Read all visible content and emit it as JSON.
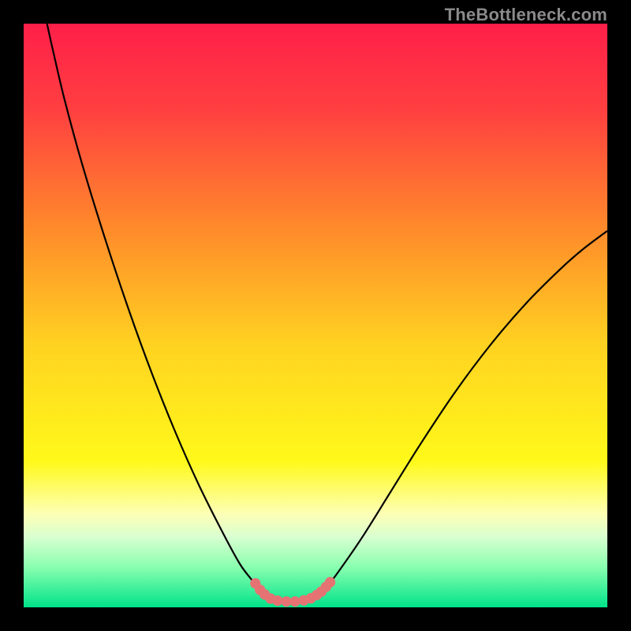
{
  "watermark": {
    "text": "TheBottleneck.com"
  },
  "chart_data": {
    "type": "line",
    "title": "",
    "xlabel": "",
    "ylabel": "",
    "xlim": [
      0,
      100
    ],
    "ylim": [
      0,
      100
    ],
    "grid": false,
    "legend": false,
    "background": {
      "gradient_stops": [
        {
          "offset": 0.0,
          "color": "#ff1f49"
        },
        {
          "offset": 0.15,
          "color": "#ff4040"
        },
        {
          "offset": 0.35,
          "color": "#ff8a2b"
        },
        {
          "offset": 0.55,
          "color": "#ffd221"
        },
        {
          "offset": 0.75,
          "color": "#fff91a"
        },
        {
          "offset": 0.84,
          "color": "#fdffb6"
        },
        {
          "offset": 0.88,
          "color": "#d8ffd0"
        },
        {
          "offset": 0.93,
          "color": "#8bffb0"
        },
        {
          "offset": 1.0,
          "color": "#00e38a"
        }
      ]
    },
    "series": [
      {
        "name": "bottleneck-curve",
        "color": "#000000",
        "points": [
          {
            "x": 4.0,
            "y": 100.0
          },
          {
            "x": 5.0,
            "y": 95.5
          },
          {
            "x": 7.0,
            "y": 87.0
          },
          {
            "x": 10.0,
            "y": 76.0
          },
          {
            "x": 14.0,
            "y": 63.0
          },
          {
            "x": 18.0,
            "y": 51.0
          },
          {
            "x": 22.0,
            "y": 40.0
          },
          {
            "x": 26.0,
            "y": 30.0
          },
          {
            "x": 30.0,
            "y": 21.0
          },
          {
            "x": 34.0,
            "y": 13.0
          },
          {
            "x": 37.0,
            "y": 7.5
          },
          {
            "x": 39.0,
            "y": 4.8
          },
          {
            "x": 40.0,
            "y": 3.5
          },
          {
            "x": 41.2,
            "y": 2.3
          },
          {
            "x": 42.5,
            "y": 1.5
          },
          {
            "x": 44.0,
            "y": 1.1
          },
          {
            "x": 46.0,
            "y": 1.0
          },
          {
            "x": 48.0,
            "y": 1.1
          },
          {
            "x": 49.5,
            "y": 1.6
          },
          {
            "x": 50.8,
            "y": 2.4
          },
          {
            "x": 52.0,
            "y": 3.6
          },
          {
            "x": 54.0,
            "y": 6.2
          },
          {
            "x": 58.0,
            "y": 12.0
          },
          {
            "x": 63.0,
            "y": 20.0
          },
          {
            "x": 68.0,
            "y": 28.0
          },
          {
            "x": 74.0,
            "y": 37.0
          },
          {
            "x": 80.0,
            "y": 45.0
          },
          {
            "x": 86.0,
            "y": 52.0
          },
          {
            "x": 92.0,
            "y": 58.0
          },
          {
            "x": 96.0,
            "y": 61.5
          },
          {
            "x": 100.0,
            "y": 64.5
          }
        ]
      }
    ],
    "markers": {
      "name": "bottom-dots",
      "color": "#e57373",
      "radius_data": 0.9,
      "points": [
        {
          "x": 39.7,
          "y": 4.1
        },
        {
          "x": 40.5,
          "y": 3.0
        },
        {
          "x": 41.3,
          "y": 2.2
        },
        {
          "x": 42.3,
          "y": 1.5
        },
        {
          "x": 43.5,
          "y": 1.15
        },
        {
          "x": 45.0,
          "y": 1.0
        },
        {
          "x": 46.5,
          "y": 1.0
        },
        {
          "x": 48.0,
          "y": 1.2
        },
        {
          "x": 49.2,
          "y": 1.55
        },
        {
          "x": 50.2,
          "y": 2.1
        },
        {
          "x": 51.0,
          "y": 2.7
        },
        {
          "x": 51.8,
          "y": 3.5
        },
        {
          "x": 52.5,
          "y": 4.3
        }
      ]
    }
  }
}
